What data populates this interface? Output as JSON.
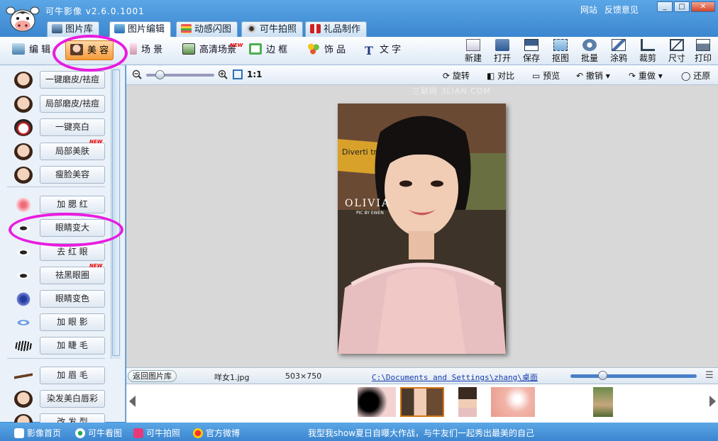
{
  "app": {
    "title": "可牛影像  v2.6.0.1001",
    "links": [
      "网站",
      "反馈意见"
    ],
    "window_buttons": [
      "_",
      "□",
      "✕"
    ]
  },
  "main_tabs": [
    "图片库",
    "图片编辑",
    "动感闪图",
    "可牛拍照",
    "礼品制作"
  ],
  "sub_tabs": [
    "编 辑",
    "美 容",
    "场 景",
    "高清场景",
    "边 框",
    "饰 品",
    "文 字"
  ],
  "new_badge": "NEW",
  "tools": [
    "新建",
    "打开",
    "保存",
    "抠图",
    "批量",
    "涂鸦",
    "裁剪",
    "尺寸",
    "打印"
  ],
  "effects": [
    {
      "label": "一键磨皮/祛痘",
      "icon": "face-icon"
    },
    {
      "label": "局部磨皮/祛痘",
      "icon": "face-icon"
    },
    {
      "label": "一键亮白",
      "icon": "opera-mask-icon"
    },
    {
      "label": "局部美肤",
      "icon": "face-icon",
      "new": true
    },
    {
      "label": "瘦脸美容",
      "icon": "face-icon"
    },
    {
      "label": "加 腮 红",
      "icon": "blush-icon"
    },
    {
      "label": "眼睛变大",
      "icon": "eye-icon"
    },
    {
      "label": "去 红 眼",
      "icon": "eye-icon"
    },
    {
      "label": "祛黑眼圈",
      "icon": "eye-icon",
      "new": true
    },
    {
      "label": "眼睛变色",
      "icon": "iris-icon"
    },
    {
      "label": "加 眼 影",
      "icon": "eyeshadow-icon"
    },
    {
      "label": "加 睫 毛",
      "icon": "eyelash-icon"
    },
    {
      "label": "加 眉 毛",
      "icon": "eyebrow-icon"
    },
    {
      "label": "染发美白唇彩",
      "icon": "face-icon"
    },
    {
      "label": "改 发 型",
      "icon": "face-icon"
    }
  ],
  "canvas_bar": {
    "ratio": "1:1",
    "rotate": "旋转",
    "compare": "对比",
    "preview": "预览",
    "undo": "撤销",
    "redo": "重做",
    "restore": "还原"
  },
  "watermark": "三联网 3LIAN.COM",
  "photo_text": {
    "name": "OLIVIA",
    "credit": "PIC BY EWEN",
    "sign": "Diverti traffi"
  },
  "status": {
    "back": "返回图片库",
    "filename": "咩女1.jpg",
    "dimensions": "503×750",
    "path": "C:\\Documents and Settings\\zhang\\桌面"
  },
  "zoom_level": 0.2,
  "status_zoom_level": 0.25,
  "footer": {
    "links": [
      "影像首页",
      "可牛看图",
      "可牛拍照",
      "官方微博"
    ],
    "marquee": "我型我show夏日自曝大作战，与牛友们一起秀出最美的自己"
  },
  "colors": {
    "title_blue": "#3b86cf",
    "highlight_orange": "#f59a3a",
    "annotation_magenta": "#e81ce0"
  }
}
